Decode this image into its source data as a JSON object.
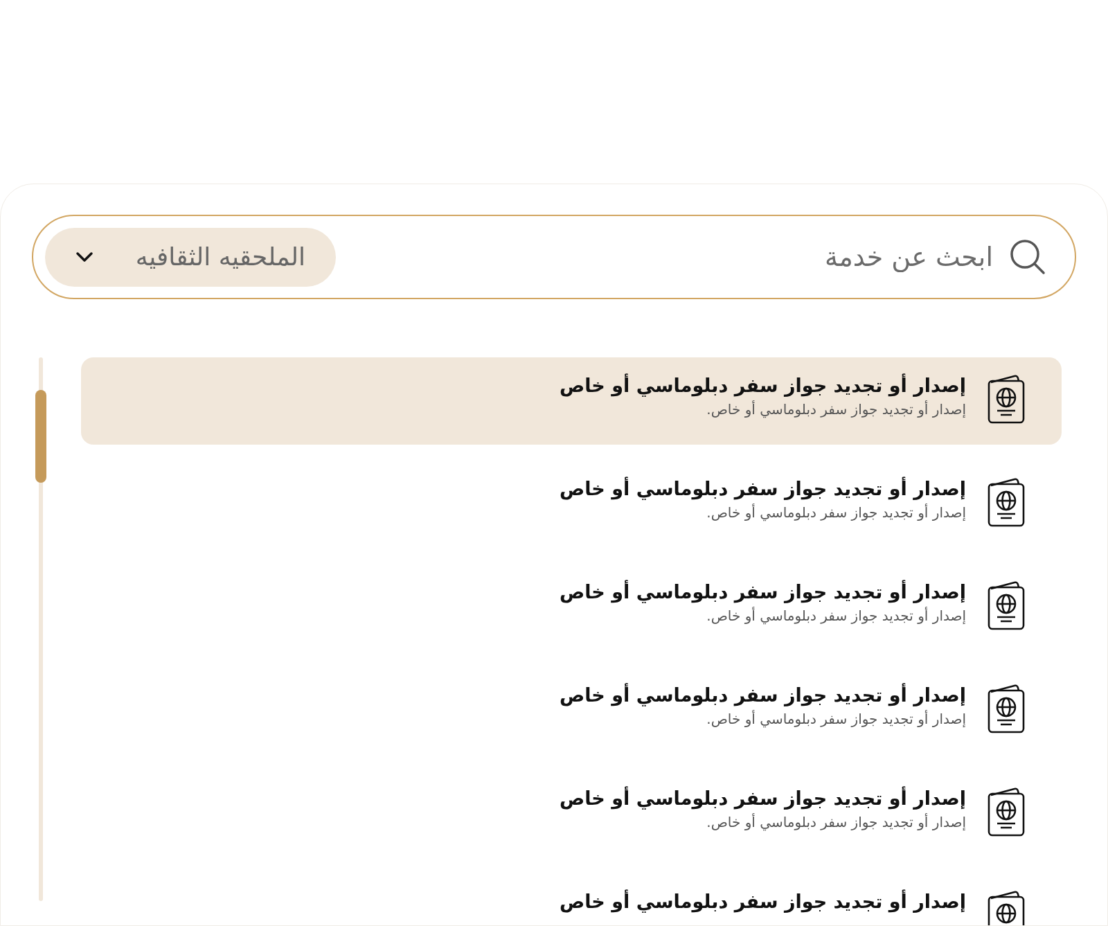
{
  "search": {
    "placeholder": "ابحث عن خدمة"
  },
  "filter": {
    "value": "الملحقيه الثقافيه"
  },
  "services": [
    {
      "title": "إصدار أو تجديد جواز سفر دبلوماسي أو خاص",
      "description": "إصدار أو تجديد جواز سفر دبلوماسي أو خاص.",
      "selected": true
    },
    {
      "title": "إصدار أو تجديد جواز سفر دبلوماسي أو خاص",
      "description": "إصدار أو تجديد جواز سفر دبلوماسي أو خاص.",
      "selected": false
    },
    {
      "title": "إصدار أو تجديد جواز سفر دبلوماسي أو خاص",
      "description": "إصدار أو تجديد جواز سفر دبلوماسي أو خاص.",
      "selected": false
    },
    {
      "title": "إصدار أو تجديد جواز سفر دبلوماسي أو خاص",
      "description": "إصدار أو تجديد جواز سفر دبلوماسي أو خاص.",
      "selected": false
    },
    {
      "title": "إصدار أو تجديد جواز سفر دبلوماسي أو خاص",
      "description": "إصدار أو تجديد جواز سفر دبلوماسي أو خاص.",
      "selected": false
    },
    {
      "title": "إصدار أو تجديد جواز سفر دبلوماسي أو خاص",
      "selected": false
    }
  ]
}
